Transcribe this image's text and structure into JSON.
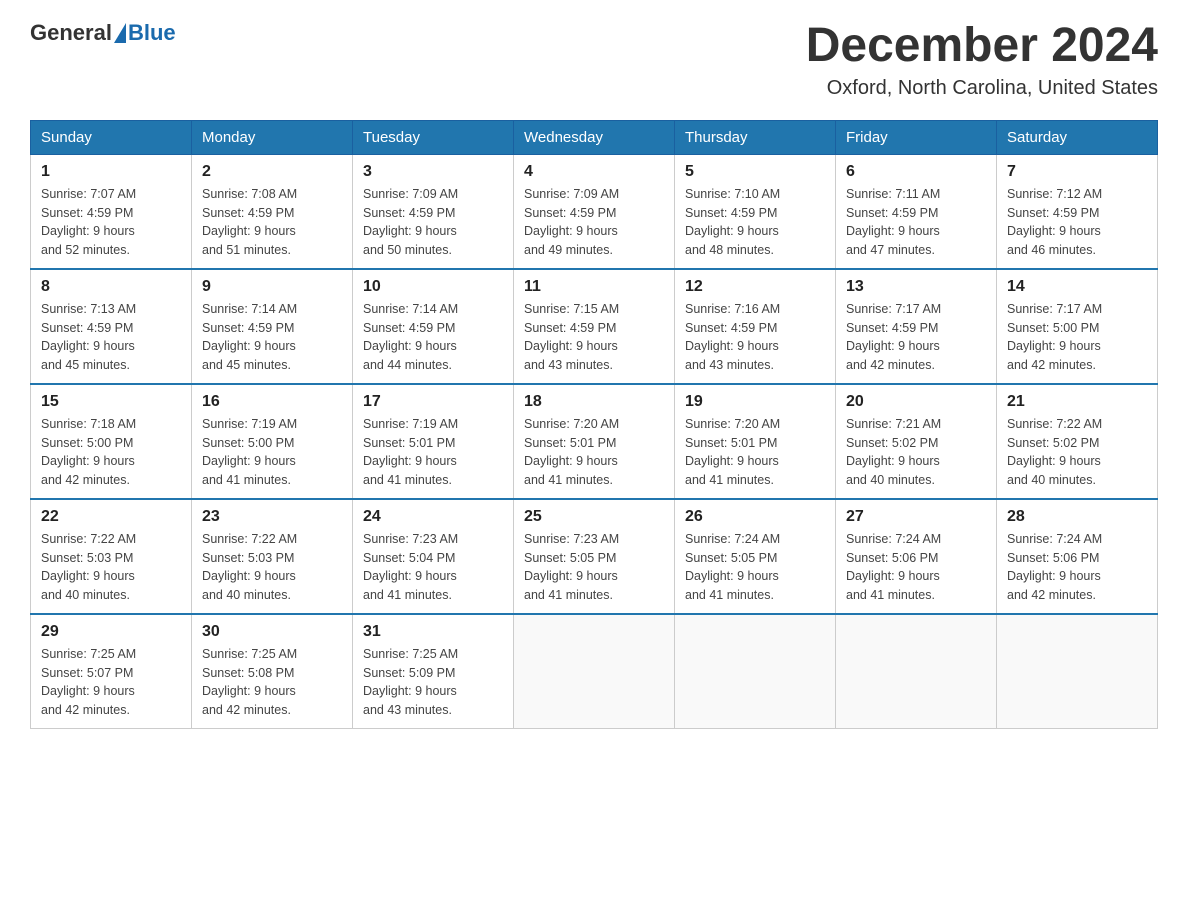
{
  "header": {
    "logo_general": "General",
    "logo_blue": "Blue",
    "title": "December 2024",
    "subtitle": "Oxford, North Carolina, United States"
  },
  "days_of_week": [
    "Sunday",
    "Monday",
    "Tuesday",
    "Wednesday",
    "Thursday",
    "Friday",
    "Saturday"
  ],
  "weeks": [
    [
      {
        "day": "1",
        "sunrise": "7:07 AM",
        "sunset": "4:59 PM",
        "daylight_hours": "9",
        "daylight_minutes": "52"
      },
      {
        "day": "2",
        "sunrise": "7:08 AM",
        "sunset": "4:59 PM",
        "daylight_hours": "9",
        "daylight_minutes": "51"
      },
      {
        "day": "3",
        "sunrise": "7:09 AM",
        "sunset": "4:59 PM",
        "daylight_hours": "9",
        "daylight_minutes": "50"
      },
      {
        "day": "4",
        "sunrise": "7:09 AM",
        "sunset": "4:59 PM",
        "daylight_hours": "9",
        "daylight_minutes": "49"
      },
      {
        "day": "5",
        "sunrise": "7:10 AM",
        "sunset": "4:59 PM",
        "daylight_hours": "9",
        "daylight_minutes": "48"
      },
      {
        "day": "6",
        "sunrise": "7:11 AM",
        "sunset": "4:59 PM",
        "daylight_hours": "9",
        "daylight_minutes": "47"
      },
      {
        "day": "7",
        "sunrise": "7:12 AM",
        "sunset": "4:59 PM",
        "daylight_hours": "9",
        "daylight_minutes": "46"
      }
    ],
    [
      {
        "day": "8",
        "sunrise": "7:13 AM",
        "sunset": "4:59 PM",
        "daylight_hours": "9",
        "daylight_minutes": "45"
      },
      {
        "day": "9",
        "sunrise": "7:14 AM",
        "sunset": "4:59 PM",
        "daylight_hours": "9",
        "daylight_minutes": "45"
      },
      {
        "day": "10",
        "sunrise": "7:14 AM",
        "sunset": "4:59 PM",
        "daylight_hours": "9",
        "daylight_minutes": "44"
      },
      {
        "day": "11",
        "sunrise": "7:15 AM",
        "sunset": "4:59 PM",
        "daylight_hours": "9",
        "daylight_minutes": "43"
      },
      {
        "day": "12",
        "sunrise": "7:16 AM",
        "sunset": "4:59 PM",
        "daylight_hours": "9",
        "daylight_minutes": "43"
      },
      {
        "day": "13",
        "sunrise": "7:17 AM",
        "sunset": "4:59 PM",
        "daylight_hours": "9",
        "daylight_minutes": "42"
      },
      {
        "day": "14",
        "sunrise": "7:17 AM",
        "sunset": "5:00 PM",
        "daylight_hours": "9",
        "daylight_minutes": "42"
      }
    ],
    [
      {
        "day": "15",
        "sunrise": "7:18 AM",
        "sunset": "5:00 PM",
        "daylight_hours": "9",
        "daylight_minutes": "42"
      },
      {
        "day": "16",
        "sunrise": "7:19 AM",
        "sunset": "5:00 PM",
        "daylight_hours": "9",
        "daylight_minutes": "41"
      },
      {
        "day": "17",
        "sunrise": "7:19 AM",
        "sunset": "5:01 PM",
        "daylight_hours": "9",
        "daylight_minutes": "41"
      },
      {
        "day": "18",
        "sunrise": "7:20 AM",
        "sunset": "5:01 PM",
        "daylight_hours": "9",
        "daylight_minutes": "41"
      },
      {
        "day": "19",
        "sunrise": "7:20 AM",
        "sunset": "5:01 PM",
        "daylight_hours": "9",
        "daylight_minutes": "41"
      },
      {
        "day": "20",
        "sunrise": "7:21 AM",
        "sunset": "5:02 PM",
        "daylight_hours": "9",
        "daylight_minutes": "40"
      },
      {
        "day": "21",
        "sunrise": "7:22 AM",
        "sunset": "5:02 PM",
        "daylight_hours": "9",
        "daylight_minutes": "40"
      }
    ],
    [
      {
        "day": "22",
        "sunrise": "7:22 AM",
        "sunset": "5:03 PM",
        "daylight_hours": "9",
        "daylight_minutes": "40"
      },
      {
        "day": "23",
        "sunrise": "7:22 AM",
        "sunset": "5:03 PM",
        "daylight_hours": "9",
        "daylight_minutes": "40"
      },
      {
        "day": "24",
        "sunrise": "7:23 AM",
        "sunset": "5:04 PM",
        "daylight_hours": "9",
        "daylight_minutes": "41"
      },
      {
        "day": "25",
        "sunrise": "7:23 AM",
        "sunset": "5:05 PM",
        "daylight_hours": "9",
        "daylight_minutes": "41"
      },
      {
        "day": "26",
        "sunrise": "7:24 AM",
        "sunset": "5:05 PM",
        "daylight_hours": "9",
        "daylight_minutes": "41"
      },
      {
        "day": "27",
        "sunrise": "7:24 AM",
        "sunset": "5:06 PM",
        "daylight_hours": "9",
        "daylight_minutes": "41"
      },
      {
        "day": "28",
        "sunrise": "7:24 AM",
        "sunset": "5:06 PM",
        "daylight_hours": "9",
        "daylight_minutes": "42"
      }
    ],
    [
      {
        "day": "29",
        "sunrise": "7:25 AM",
        "sunset": "5:07 PM",
        "daylight_hours": "9",
        "daylight_minutes": "42"
      },
      {
        "day": "30",
        "sunrise": "7:25 AM",
        "sunset": "5:08 PM",
        "daylight_hours": "9",
        "daylight_minutes": "42"
      },
      {
        "day": "31",
        "sunrise": "7:25 AM",
        "sunset": "5:09 PM",
        "daylight_hours": "9",
        "daylight_minutes": "43"
      },
      null,
      null,
      null,
      null
    ]
  ]
}
